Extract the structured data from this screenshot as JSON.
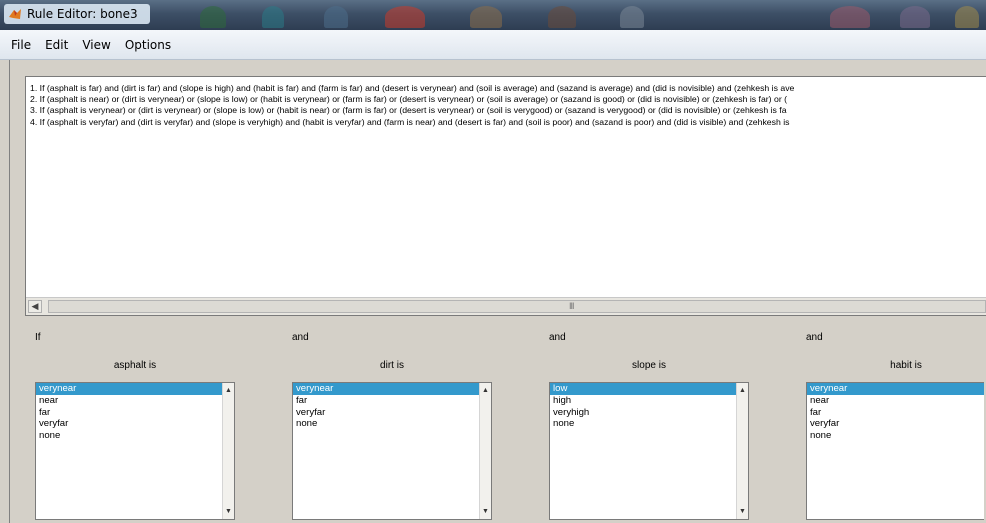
{
  "window": {
    "title": "Rule Editor: bone3"
  },
  "menu": [
    "File",
    "Edit",
    "View",
    "Options"
  ],
  "rules": [
    "1. If (asphalt is far) and (dirt is far) and (slope is high) and (habit is far) and (farm is far) and (desert is verynear) and (soil is average) and (sazand is average) and (did is novisible) and (zehkesh is ave",
    "2. If (asphalt is near) or (dirt is verynear) or (slope is low) or (habit is verynear) or (farm is far) or (desert is verynear) or (soil is average) or (sazand is good) or (did is novisible) or (zehkesh is far) or (",
    "3. If (asphalt is verynear) or (dirt is verynear) or (slope is low) or (habit is near) or (farm is far) or (desert is verynear) or (soil is verygood) or (sazand is verygood) or (did is novisible) or (zehkesh is fa",
    "4. If (asphalt is veryfar) and (dirt is veryfar) and (slope is veryhigh) and (habit is veryfar) and (farm is near) and (desert is far) and (soil is poor) and (sazand is poor) and (did is visible) and (zehkesh is"
  ],
  "scrollbar": {
    "grip": "III"
  },
  "variables": [
    {
      "connector": "If",
      "label": "asphalt is",
      "options": [
        "verynear",
        "near",
        "far",
        "veryfar",
        "none"
      ]
    },
    {
      "connector": "and",
      "label": "dirt is",
      "options": [
        "verynear",
        "far",
        "veryfar",
        "none"
      ]
    },
    {
      "connector": "and",
      "label": "slope is",
      "options": [
        "low",
        "high",
        "veryhigh",
        "none"
      ]
    },
    {
      "connector": "and",
      "label": "habit is",
      "options": [
        "verynear",
        "near",
        "far",
        "veryfar",
        "none"
      ]
    }
  ],
  "selected_option_index": 0,
  "colors": {
    "selection": "#3399cc",
    "title_gradient_top": "#5a6f86",
    "menubar": "#eef2f7"
  },
  "icons": {
    "app": "matlab-icon",
    "scroll_up": "chevron-up-icon",
    "scroll_down": "chevron-down-icon",
    "scroll_left": "chevron-left-icon"
  }
}
